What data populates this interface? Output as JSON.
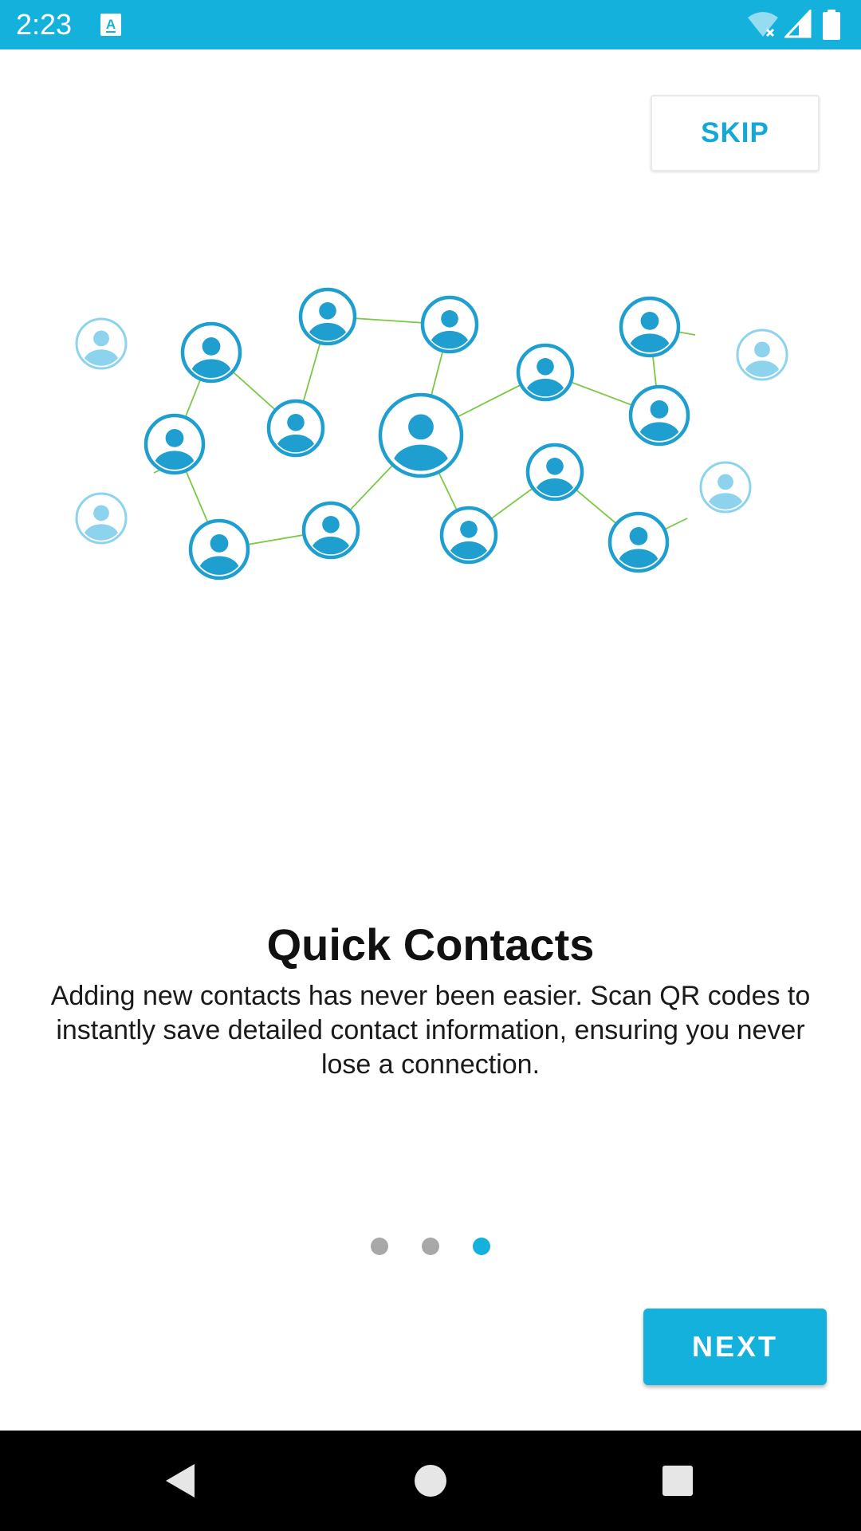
{
  "status_bar": {
    "time": "2:23",
    "background_color": "#14b1dd",
    "icons": [
      "text-a-notification-icon",
      "wifi-off-icon",
      "cell-signal-icon",
      "battery-icon"
    ]
  },
  "onboarding": {
    "skip_label": "SKIP",
    "title": "Quick Contacts",
    "description": "Adding new contacts has never been easier. Scan QR codes to instantly save detailed contact information, ensuring you never lose a connection.",
    "next_label": "NEXT",
    "page_count": 3,
    "current_page": 3,
    "illustration_icon": "contacts-network-illustration",
    "accent_color": "#14b1dd",
    "dot_inactive_color": "#a8a8a8",
    "network_line_color": "#7ac943"
  },
  "nav_bar": {
    "icons": [
      "back-icon",
      "home-icon",
      "recents-icon"
    ]
  }
}
